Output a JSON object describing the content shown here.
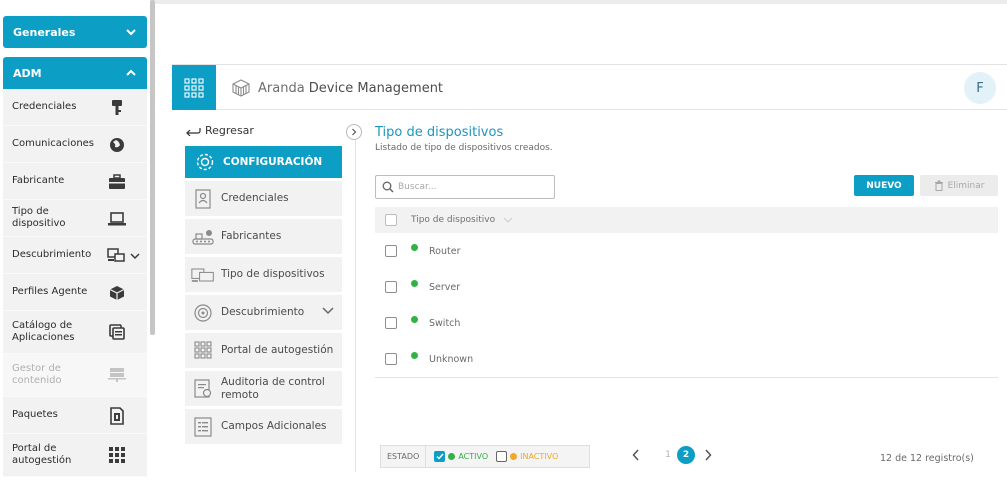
{
  "sidebar": {
    "groups": [
      {
        "label": "Generales",
        "expanded": false
      },
      {
        "label": "ADM",
        "expanded": true
      }
    ],
    "items": [
      {
        "label": "Credenciales",
        "icon": "key-icon"
      },
      {
        "label": "Comunicaciones",
        "icon": "globe-icon"
      },
      {
        "label": "Fabricante",
        "icon": "briefcase-icon"
      },
      {
        "label": "Tipo de dispositivo",
        "icon": "laptop-icon"
      },
      {
        "label": "Descubrimiento",
        "icon": "network-discovery-icon"
      },
      {
        "label": "Perfiles Agente",
        "icon": "cube-icon"
      },
      {
        "label": "Catálogo de Aplicaciones",
        "icon": "app-catalog-icon"
      },
      {
        "label": "Gestor de contenido",
        "icon": "server-icon",
        "disabled": true
      },
      {
        "label": "Paquetes",
        "icon": "package-icon"
      },
      {
        "label": "Portal de autogestión",
        "icon": "grid-icon"
      }
    ]
  },
  "header": {
    "brand_prefix": "Aranda ",
    "brand_name": "Device Management",
    "user_initial": "F"
  },
  "config_nav": {
    "back_label": "Regresar",
    "active_label": "CONFIGURACIÓN",
    "items": [
      {
        "label": "Credenciales",
        "icon": "credentials-icon"
      },
      {
        "label": "Fabricantes",
        "icon": "factory-icon"
      },
      {
        "label": "Tipo de dispositivos",
        "icon": "devices-icon"
      },
      {
        "label": "Descubrimiento",
        "icon": "radar-icon",
        "expandable": true
      },
      {
        "label": "Portal de autogestión",
        "icon": "grid-icon"
      },
      {
        "label": "Auditoria de control remoto",
        "icon": "audit-icon"
      },
      {
        "label": "Campos Adicionales",
        "icon": "form-fields-icon"
      }
    ]
  },
  "main": {
    "title": "Tipo de dispositivos",
    "subtitle": "Listado de tipo de dispositivos creados.",
    "search_placeholder": "Buscar...",
    "new_button": "NUEVO",
    "delete_button": "Eliminar",
    "table": {
      "column": "Tipo de dispositivo",
      "rows": [
        {
          "name": "Router",
          "status": "active"
        },
        {
          "name": "Server",
          "status": "active"
        },
        {
          "name": "Switch",
          "status": "active"
        },
        {
          "name": "Unknown",
          "status": "active"
        }
      ]
    }
  },
  "footer": {
    "status_label": "ESTADO",
    "active_label": "ACTIVO",
    "inactive_label": "INACTIVO",
    "active_checked": true,
    "inactive_checked": false,
    "pages": [
      "1",
      "2"
    ],
    "current_page": "2",
    "record_count": "12 de 12 registro(s)"
  },
  "colors": {
    "accent": "#0d9ec5",
    "active": "#2fb344",
    "inactive": "#f5a623",
    "title": "#1f95bd"
  }
}
